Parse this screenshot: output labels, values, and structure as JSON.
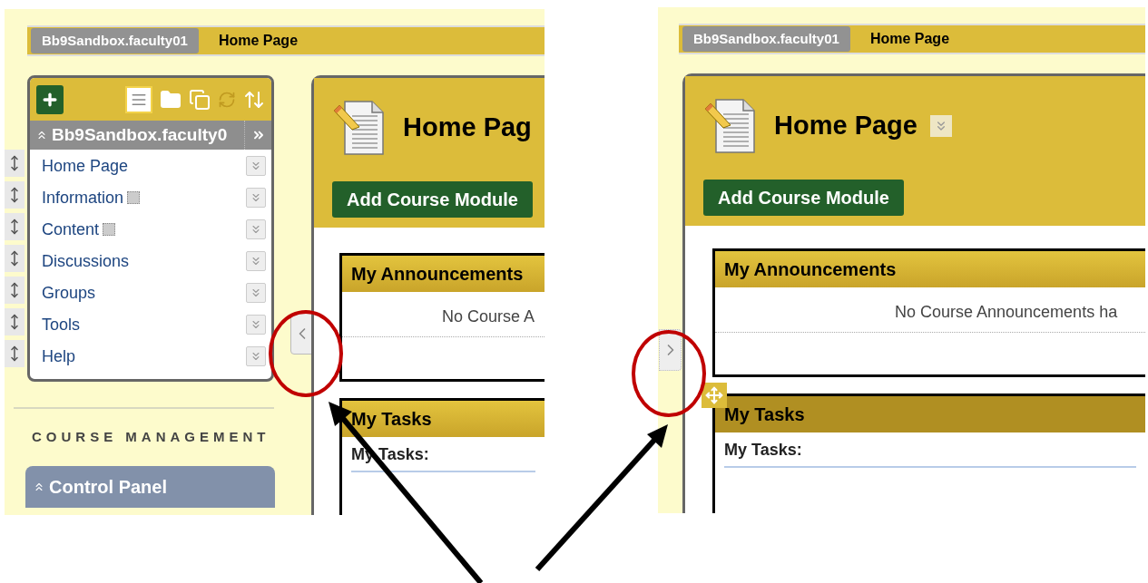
{
  "screenshots": [
    {
      "breadcrumb": {
        "course": "Bb9Sandbox.faculty01",
        "page": "Home Page"
      },
      "course_menu": {
        "visible": true,
        "title": "Bb9Sandbox.faculty0",
        "items": [
          {
            "label": "Home Page",
            "badge": false
          },
          {
            "label": "Information",
            "badge": true
          },
          {
            "label": "Content",
            "badge": true
          },
          {
            "label": "Discussions",
            "badge": false
          },
          {
            "label": "Groups",
            "badge": false
          },
          {
            "label": "Tools",
            "badge": false
          },
          {
            "label": "Help",
            "badge": false
          }
        ],
        "section_heading": "COURSE MANAGEMENT",
        "control_panel": "Control Panel"
      },
      "menu_toggle": {
        "expanded": true
      },
      "content": {
        "title": "Home Pag",
        "title_menu": false,
        "button": "Add Course Module",
        "modules": [
          {
            "title": "My Announcements",
            "body": "No Course A",
            "highlighted": false
          },
          {
            "title": "My Tasks",
            "subheading": "My Tasks:",
            "highlighted": false
          }
        ]
      }
    },
    {
      "breadcrumb": {
        "course": "Bb9Sandbox.faculty01",
        "page": "Home Page"
      },
      "course_menu": {
        "visible": false
      },
      "menu_toggle": {
        "expanded": false
      },
      "content": {
        "title": "Home Page",
        "title_menu": true,
        "button": "Add Course Module",
        "modules": [
          {
            "title": "My Announcements",
            "body": "No Course Announcements ha",
            "highlighted": false
          },
          {
            "title": "My Tasks",
            "subheading": "My Tasks:",
            "highlighted": true
          }
        ]
      }
    }
  ]
}
